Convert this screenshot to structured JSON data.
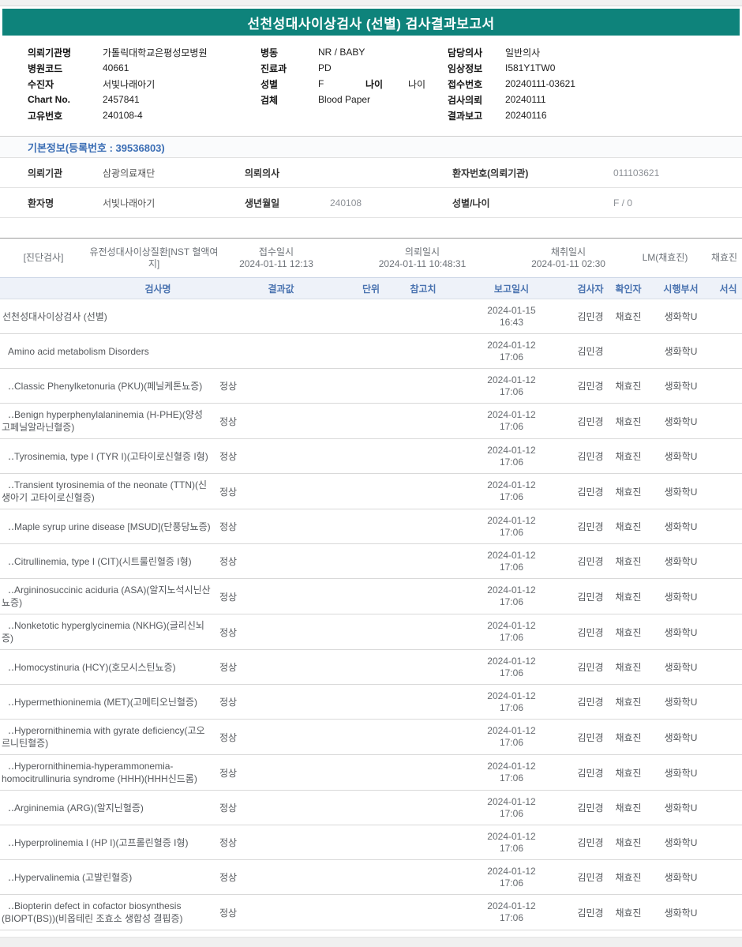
{
  "report": {
    "title": "선천성대사이상검사 (선별) 검사결과보고서"
  },
  "colors": {
    "header_teal": "#0e837b",
    "section_title_blue": "#3a6db4",
    "table_header_blue": "#4a73b0"
  },
  "patient_header": {
    "left": [
      {
        "label": "의뢰기관명",
        "value": "가톨릭대학교은평성모병원"
      },
      {
        "label": "병원코드",
        "value": "40661"
      },
      {
        "label": "수진자",
        "value": "서빛나래아기"
      },
      {
        "label": "Chart No.",
        "value": "2457841"
      },
      {
        "label": "고유번호",
        "value": "240108-4"
      }
    ],
    "middle": [
      {
        "label": "병동",
        "value": "NR / BABY"
      },
      {
        "label": "진료과",
        "value": "PD"
      },
      {
        "label": "성별",
        "value": "F",
        "label2": "나이",
        "value2": "나이"
      },
      {
        "label": "검체",
        "value": "Blood Paper"
      }
    ],
    "right": [
      {
        "label": "담당의사",
        "value": "일반의사"
      },
      {
        "label": "임상정보",
        "value": "I581Y1TW0"
      },
      {
        "label": "접수번호",
        "value": "20240111-03621"
      },
      {
        "label": "검사의뢰",
        "value": "20240111"
      },
      {
        "label": "결과보고",
        "value": "20240116"
      }
    ]
  },
  "basic_info": {
    "title": "기본정보(등록번호 : 39536803)",
    "row1": {
      "label1": "의뢰기관",
      "value1": "삼광의료재단",
      "label2": "의뢰의사",
      "value2": "",
      "label3": "환자번호(의뢰기관)",
      "value3": "011103621"
    },
    "row2": {
      "label1": "환자명",
      "value1": "서빛나래아기",
      "label2": "생년월일",
      "value2": "240108",
      "label3": "성별/나이",
      "value3": "F / 0"
    }
  },
  "diagnostic_row": {
    "tag": "[진단검사]",
    "test_group": "유전성대사이상질환[NST 혈액여지]",
    "receipt_label": "접수일시",
    "receipt_datetime": "2024-01-11 12:13",
    "request_label": "의뢰일시",
    "request_datetime": "2024-01-11 10:48:31",
    "collection_label": "채취일시",
    "collection_datetime": "2024-01-11 02:30",
    "collector": "LM(채효진)",
    "collector_name": "채효진"
  },
  "results_table": {
    "headers": [
      "검사명",
      "결과값",
      "단위",
      "참고치",
      "보고일시",
      "검사자",
      "확인자",
      "시행부서",
      "서식"
    ],
    "rows": [
      {
        "name": "선천성대사이상검사 (선별)",
        "indent": 0,
        "result": "",
        "unit": "",
        "ref": "",
        "report_date": "2024-01-15",
        "report_time": "16:43",
        "tester": "김민경",
        "confirmer": "채효진",
        "dept": "생화학U",
        "form": ""
      },
      {
        "name": "Amino acid metabolism Disorders",
        "indent": 1,
        "result": "",
        "unit": "",
        "ref": "",
        "report_date": "2024-01-12",
        "report_time": "17:06",
        "tester": "김민경",
        "confirmer": "",
        "dept": "생화학U",
        "form": ""
      },
      {
        "name": "‥Classic Phenylketonuria (PKU)(페닐케톤뇨증)",
        "indent": 1,
        "result": "정상",
        "unit": "",
        "ref": "",
        "report_date": "2024-01-12",
        "report_time": "17:06",
        "tester": "김민경",
        "confirmer": "채효진",
        "dept": "생화학U",
        "form": ""
      },
      {
        "name": "‥Benign hyperphenylalaninemia (H-PHE)(양성 고페닐알라닌혈증)",
        "indent": 1,
        "result": "정상",
        "unit": "",
        "ref": "",
        "report_date": "2024-01-12",
        "report_time": "17:06",
        "tester": "김민경",
        "confirmer": "채효진",
        "dept": "생화학U",
        "form": ""
      },
      {
        "name": "‥Tyrosinemia, type I (TYR I)(고타이로신혈증 I형)",
        "indent": 1,
        "result": "정상",
        "unit": "",
        "ref": "",
        "report_date": "2024-01-12",
        "report_time": "17:06",
        "tester": "김민경",
        "confirmer": "채효진",
        "dept": "생화학U",
        "form": ""
      },
      {
        "name": "‥Transient tyrosinemia of the neonate (TTN)(신생아기 고타이로신혈증)",
        "indent": 1,
        "result": "정상",
        "unit": "",
        "ref": "",
        "report_date": "2024-01-12",
        "report_time": "17:06",
        "tester": "김민경",
        "confirmer": "채효진",
        "dept": "생화학U",
        "form": ""
      },
      {
        "name": "‥Maple syrup urine disease [MSUD](단풍당뇨증)",
        "indent": 1,
        "result": "정상",
        "unit": "",
        "ref": "",
        "report_date": "2024-01-12",
        "report_time": "17:06",
        "tester": "김민경",
        "confirmer": "채효진",
        "dept": "생화학U",
        "form": ""
      },
      {
        "name": "‥Citrullinemia, type I (CIT)(시트룰린혈증 I형)",
        "indent": 1,
        "result": "정상",
        "unit": "",
        "ref": "",
        "report_date": "2024-01-12",
        "report_time": "17:06",
        "tester": "김민경",
        "confirmer": "채효진",
        "dept": "생화학U",
        "form": ""
      },
      {
        "name": "‥Argininosuccinic aciduria (ASA)(알지노석시닌산뇨증)",
        "indent": 1,
        "result": "정상",
        "unit": "",
        "ref": "",
        "report_date": "2024-01-12",
        "report_time": "17:06",
        "tester": "김민경",
        "confirmer": "채효진",
        "dept": "생화학U",
        "form": ""
      },
      {
        "name": "‥Nonketotic hyperglycinemia (NKHG)(글리신뇌증)",
        "indent": 1,
        "result": "정상",
        "unit": "",
        "ref": "",
        "report_date": "2024-01-12",
        "report_time": "17:06",
        "tester": "김민경",
        "confirmer": "채효진",
        "dept": "생화학U",
        "form": ""
      },
      {
        "name": "‥Homocystinuria (HCY)(호모시스틴뇨증)",
        "indent": 1,
        "result": "정상",
        "unit": "",
        "ref": "",
        "report_date": "2024-01-12",
        "report_time": "17:06",
        "tester": "김민경",
        "confirmer": "채효진",
        "dept": "생화학U",
        "form": ""
      },
      {
        "name": "‥Hypermethioninemia (MET)(고메티오닌혈증)",
        "indent": 1,
        "result": "정상",
        "unit": "",
        "ref": "",
        "report_date": "2024-01-12",
        "report_time": "17:06",
        "tester": "김민경",
        "confirmer": "채효진",
        "dept": "생화학U",
        "form": ""
      },
      {
        "name": "‥Hyperornithinemia with gyrate deficiency(고오르니틴혈증)",
        "indent": 1,
        "result": "정상",
        "unit": "",
        "ref": "",
        "report_date": "2024-01-12",
        "report_time": "17:06",
        "tester": "김민경",
        "confirmer": "채효진",
        "dept": "생화학U",
        "form": ""
      },
      {
        "name": "‥Hyperornithinemia-hyperammonemia-homocitrullinuria syndrome (HHH)(HHH신드롬)",
        "indent": 1,
        "result": "정상",
        "unit": "",
        "ref": "",
        "report_date": "2024-01-12",
        "report_time": "17:06",
        "tester": "김민경",
        "confirmer": "채효진",
        "dept": "생화학U",
        "form": ""
      },
      {
        "name": "‥Argininemia (ARG)(알지닌혈증)",
        "indent": 1,
        "result": "정상",
        "unit": "",
        "ref": "",
        "report_date": "2024-01-12",
        "report_time": "17:06",
        "tester": "김민경",
        "confirmer": "채효진",
        "dept": "생화학U",
        "form": ""
      },
      {
        "name": "‥Hyperprolinemia I (HP I)(고프롤린혈증 I형)",
        "indent": 1,
        "result": "정상",
        "unit": "",
        "ref": "",
        "report_date": "2024-01-12",
        "report_time": "17:06",
        "tester": "김민경",
        "confirmer": "채효진",
        "dept": "생화학U",
        "form": ""
      },
      {
        "name": "‥Hypervalinemia (고발린혈증)",
        "indent": 1,
        "result": "정상",
        "unit": "",
        "ref": "",
        "report_date": "2024-01-12",
        "report_time": "17:06",
        "tester": "김민경",
        "confirmer": "채효진",
        "dept": "생화학U",
        "form": ""
      },
      {
        "name": "‥Biopterin defect in cofactor biosynthesis (BIOPT(BS))(비옵테린 조효소 생합성 결핍증)",
        "indent": 1,
        "result": "정상",
        "unit": "",
        "ref": "",
        "report_date": "2024-01-12",
        "report_time": "17:06",
        "tester": "김민경",
        "confirmer": "채효진",
        "dept": "생화학U",
        "form": ""
      }
    ]
  }
}
